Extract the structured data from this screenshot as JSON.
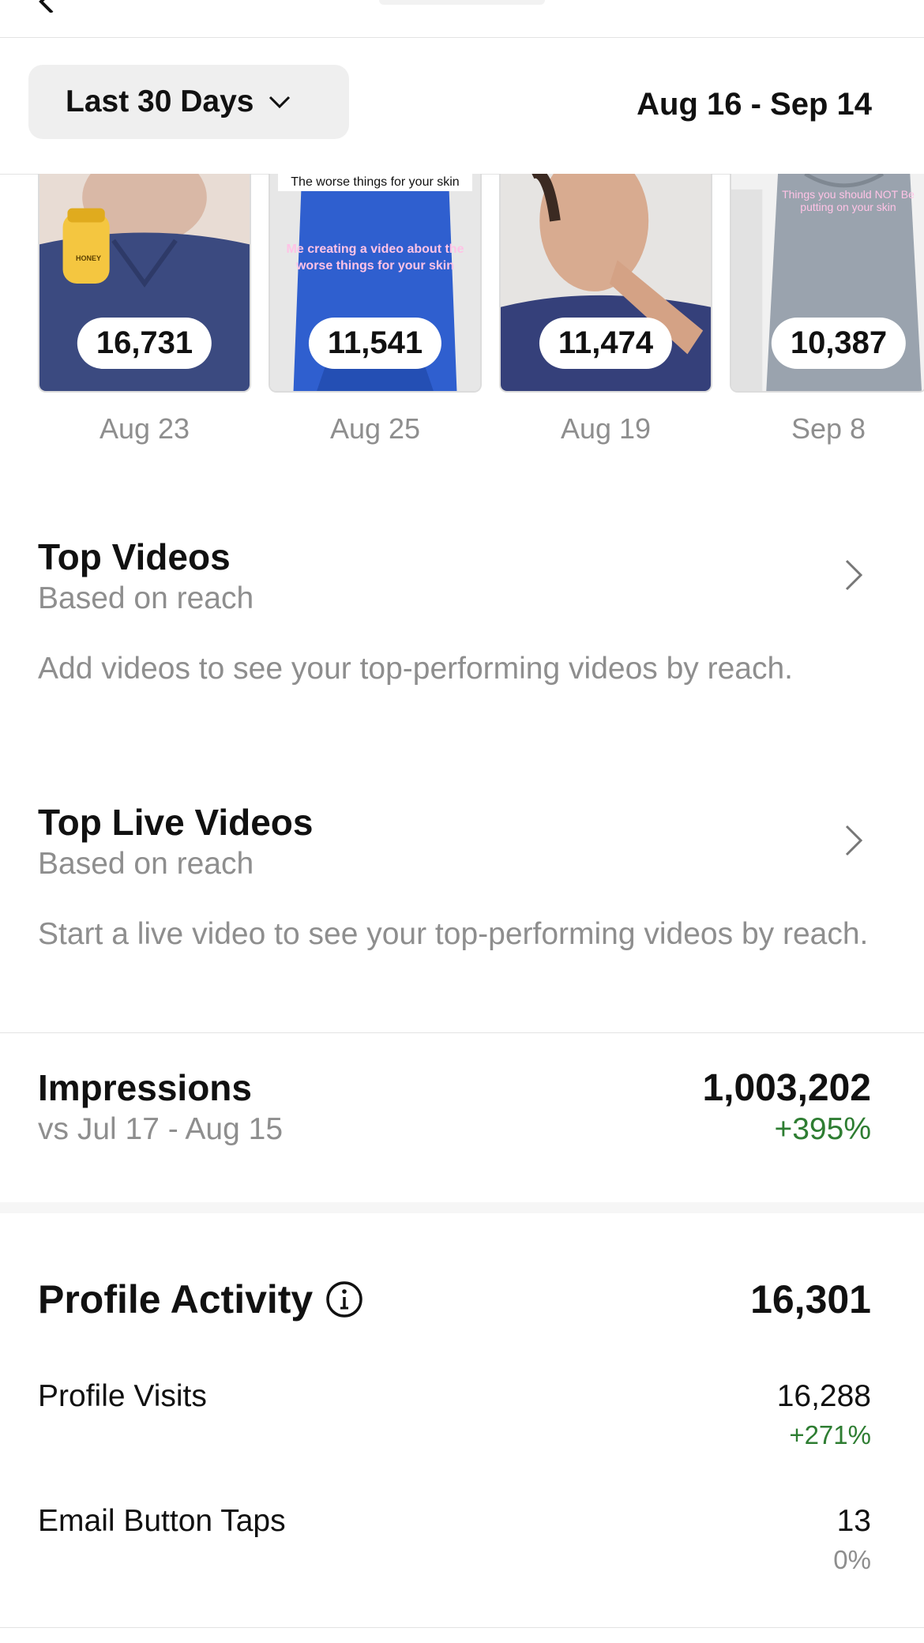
{
  "filter": {
    "range_label": "Last 30 Days",
    "date_range": "Aug 16 - Sep 14"
  },
  "top_posts": [
    {
      "value": "16,731",
      "date": "Aug 23"
    },
    {
      "value": "11,541",
      "date": "Aug 25",
      "caption_top": "The worse things for your skin",
      "caption_overlay": "Me creating a video about the worse things for your skin"
    },
    {
      "value": "11,474",
      "date": "Aug 19"
    },
    {
      "value": "10,387",
      "date": "Sep 8",
      "caption_overlay": "Things you should NOT Be putting on your skin"
    }
  ],
  "thumb_badge": "HONEY",
  "top_videos": {
    "title": "Top Videos",
    "subtitle": "Based on reach",
    "description": "Add videos to see your top-performing videos by reach."
  },
  "top_live_videos": {
    "title": "Top Live Videos",
    "subtitle": "Based on reach",
    "description": "Start a live video to see your top-performing videos by reach."
  },
  "impressions": {
    "title": "Impressions",
    "comparison": "vs Jul 17 - Aug 15",
    "value": "1,003,202",
    "change": "+395%"
  },
  "profile_activity": {
    "title": "Profile Activity",
    "total": "16,301",
    "rows": [
      {
        "label": "Profile Visits",
        "value": "16,288",
        "change": "+271%"
      },
      {
        "label": "Email Button Taps",
        "value": "13",
        "change": "0%"
      }
    ]
  },
  "colors": {
    "positive": "#2e7d32",
    "neutral_change": "#8e8e8e",
    "secondary_text": "#8e8e8e"
  }
}
